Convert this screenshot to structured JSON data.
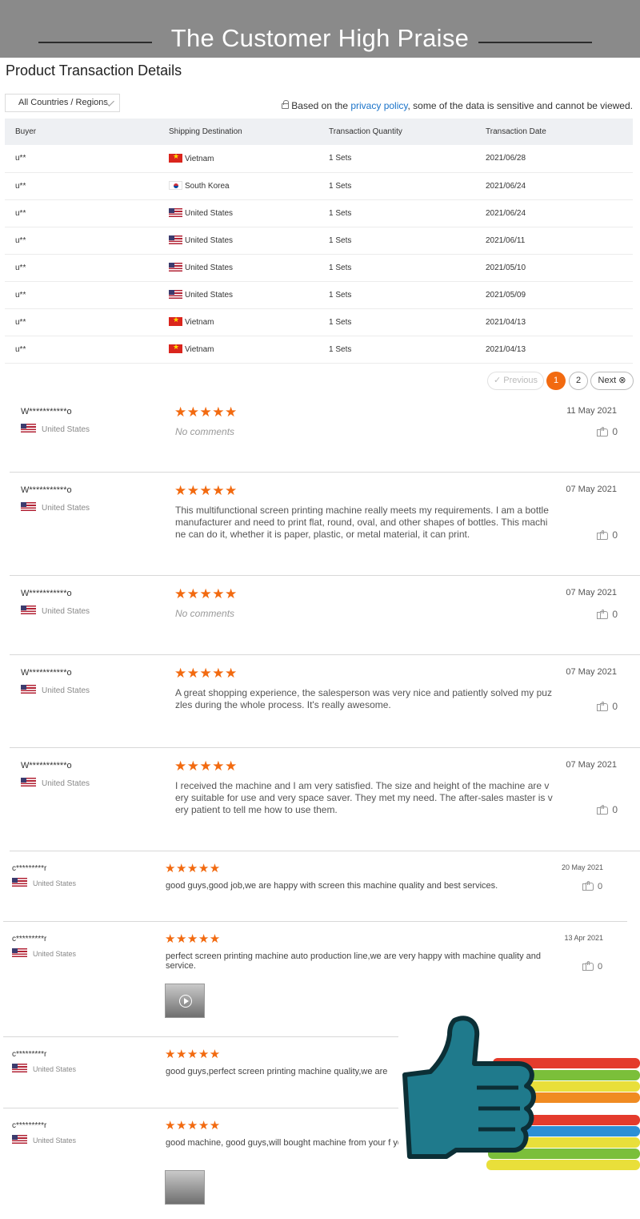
{
  "banner": {
    "title": "The Customer High Praise"
  },
  "section_title": "Product Transaction Details",
  "filter": {
    "country_select": "All Countries / Regions"
  },
  "privacy": {
    "prefix": "Based on the ",
    "link": "privacy policy",
    "suffix": ", some of the data is sensitive and cannot be viewed."
  },
  "table": {
    "headers": [
      "Buyer",
      "Shipping Destination",
      "Transaction Quantity",
      "Transaction Date"
    ],
    "rows": [
      {
        "buyer": "u**",
        "flag": "vn",
        "destination": "Vietnam",
        "quantity": "1 Sets",
        "date": "2021/06/28"
      },
      {
        "buyer": "u**",
        "flag": "kr",
        "destination": "South Korea",
        "quantity": "1 Sets",
        "date": "2021/06/24"
      },
      {
        "buyer": "u**",
        "flag": "us",
        "destination": "United States",
        "quantity": "1 Sets",
        "date": "2021/06/24"
      },
      {
        "buyer": "u**",
        "flag": "us",
        "destination": "United States",
        "quantity": "1 Sets",
        "date": "2021/06/11"
      },
      {
        "buyer": "u**",
        "flag": "us",
        "destination": "United States",
        "quantity": "1 Sets",
        "date": "2021/05/10"
      },
      {
        "buyer": "u**",
        "flag": "us",
        "destination": "United States",
        "quantity": "1 Sets",
        "date": "2021/05/09"
      },
      {
        "buyer": "u**",
        "flag": "vn",
        "destination": "Vietnam",
        "quantity": "1 Sets",
        "date": "2021/04/13"
      },
      {
        "buyer": "u**",
        "flag": "vn",
        "destination": "Vietnam",
        "quantity": "1 Sets",
        "date": "2021/04/13"
      }
    ]
  },
  "pagination": {
    "previous": "Previous",
    "page1": "1",
    "page2": "2",
    "next": "Next"
  },
  "reviews": [
    {
      "name": "W***********o",
      "country": "United States",
      "stars": "★★★★★",
      "date": "11 May 2021",
      "text": "No comments",
      "likes": "0"
    },
    {
      "name": "W***********o",
      "country": "United States",
      "stars": "★★★★★",
      "date": "07 May 2021",
      "text": "This multifunctional screen printing machine really meets my requirements. I am a bottle manufacturer and need to print flat, round, oval, and other shapes of bottles. This machine can do it, whether it is paper, plastic, or metal material, it can print.",
      "likes": "0"
    },
    {
      "name": "W***********o",
      "country": "United States",
      "stars": "★★★★★",
      "date": "07 May 2021",
      "text": "No comments",
      "likes": "0"
    },
    {
      "name": "W***********o",
      "country": "United States",
      "stars": "★★★★★",
      "date": "07 May 2021",
      "text": "A great shopping experience, the salesperson was very nice and patiently solved my puzzles during the whole process. It's really awesome.",
      "likes": "0"
    },
    {
      "name": "W***********o",
      "country": "United States",
      "stars": "★★★★★",
      "date": "07 May 2021",
      "text": "I received the machine and I am very satisfied. The size and height of the machine are very suitable for use and very space saver. They met my need. The after-sales master is very patient to tell me how to use them.",
      "likes": "0"
    }
  ],
  "reviews2": [
    {
      "name": "c*********r",
      "country": "United States",
      "stars": "★★★★★",
      "date": "20 May 2021",
      "text": "good guys,good job,we are happy with screen this machine quality and best services.",
      "likes": "0"
    },
    {
      "name": "c*********r",
      "country": "United States",
      "stars": "★★★★★",
      "date": "13 Apr 2021",
      "text": "perfect screen printing machine auto production line,we are very happy with machine quality and service.",
      "likes": "0"
    },
    {
      "name": "c*********r",
      "country": "United States",
      "stars": "★★★★★",
      "date": "",
      "text": "good guys,perfect screen printing machine quality,we are",
      "likes": ""
    },
    {
      "name": "c*********r",
      "country": "United States",
      "stars": "★★★★★",
      "date": "",
      "text": "good machine, good guys,will bought machine from your f your help.",
      "likes": ""
    }
  ],
  "colors": {
    "accent": "#f26a10",
    "link": "#1a73c9",
    "banner": "#8a8a8a",
    "thumb_art": "#1f7a8c"
  }
}
